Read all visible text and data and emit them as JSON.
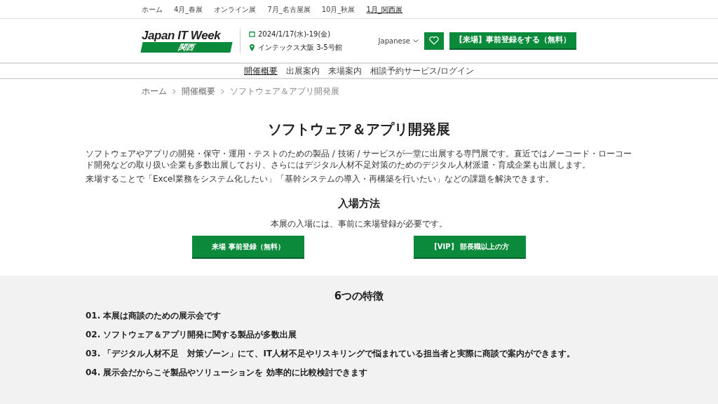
{
  "top_nav": [
    {
      "label": "ホーム",
      "selected": false
    },
    {
      "label": "4月_春展",
      "selected": false
    },
    {
      "label": "オンライン展",
      "selected": false
    },
    {
      "label": "7月_名古屋展",
      "selected": false
    },
    {
      "label": "10月_秋展",
      "selected": false
    },
    {
      "label": "1月_関西展",
      "selected": true
    }
  ],
  "header": {
    "logo_title": "Japan IT Week",
    "logo_region": "関西",
    "date": "2024/1/17(水)-19(金)",
    "venue": "インテックス大阪 3-5号館",
    "language": "Japanese",
    "register_button": "【来場】事前登録をする（無料）"
  },
  "sub_nav": [
    {
      "label": "開催概要",
      "selected": true
    },
    {
      "label": "出展案内",
      "selected": false
    },
    {
      "label": "来場案内",
      "selected": false
    },
    {
      "label": "相談予約サービス/ログイン",
      "selected": false
    }
  ],
  "breadcrumb": [
    "ホーム",
    "開催概要",
    "ソフトウェア＆アプリ開発展"
  ],
  "title": "ソフトウェア＆アプリ開発展",
  "paragraphs": [
    "ソフトウェアやアプリの開発・保守・運用・テストのための製品 / 技術 / サービスが一堂に出展する専門展です。直近ではノーコード・ローコード開発などの取り扱い企業も多数出展しており、さらにはデジタル人材不足対策のためのデジタル人材派遣・育成企業も出展します。",
    "来場することで「Excel業務をシステム化したい」「基幹システムの導入・再構築を行いたい」などの課題を解決できます。"
  ],
  "admission": {
    "heading": "入場方法",
    "note": "本展の入場には、事前に来場登録が必要です。",
    "buttons": [
      "来場 事前登録（無料）",
      "【VIP】 部長職以上の方"
    ]
  },
  "features": {
    "heading": "6つの特徴",
    "items": [
      "01. 本展は商談のための展示会です",
      "02. ソフトウェア＆アプリ開発に関する製品が多数出展",
      "03. 「デジタル人材不足　対策ゾーン」にて、IT人材不足やリスキリングで悩まれている担当者と実際に商談で案内ができます。",
      "04. 展示会だからこそ製品やソリューションを 効率的に比較検討できます"
    ]
  }
}
